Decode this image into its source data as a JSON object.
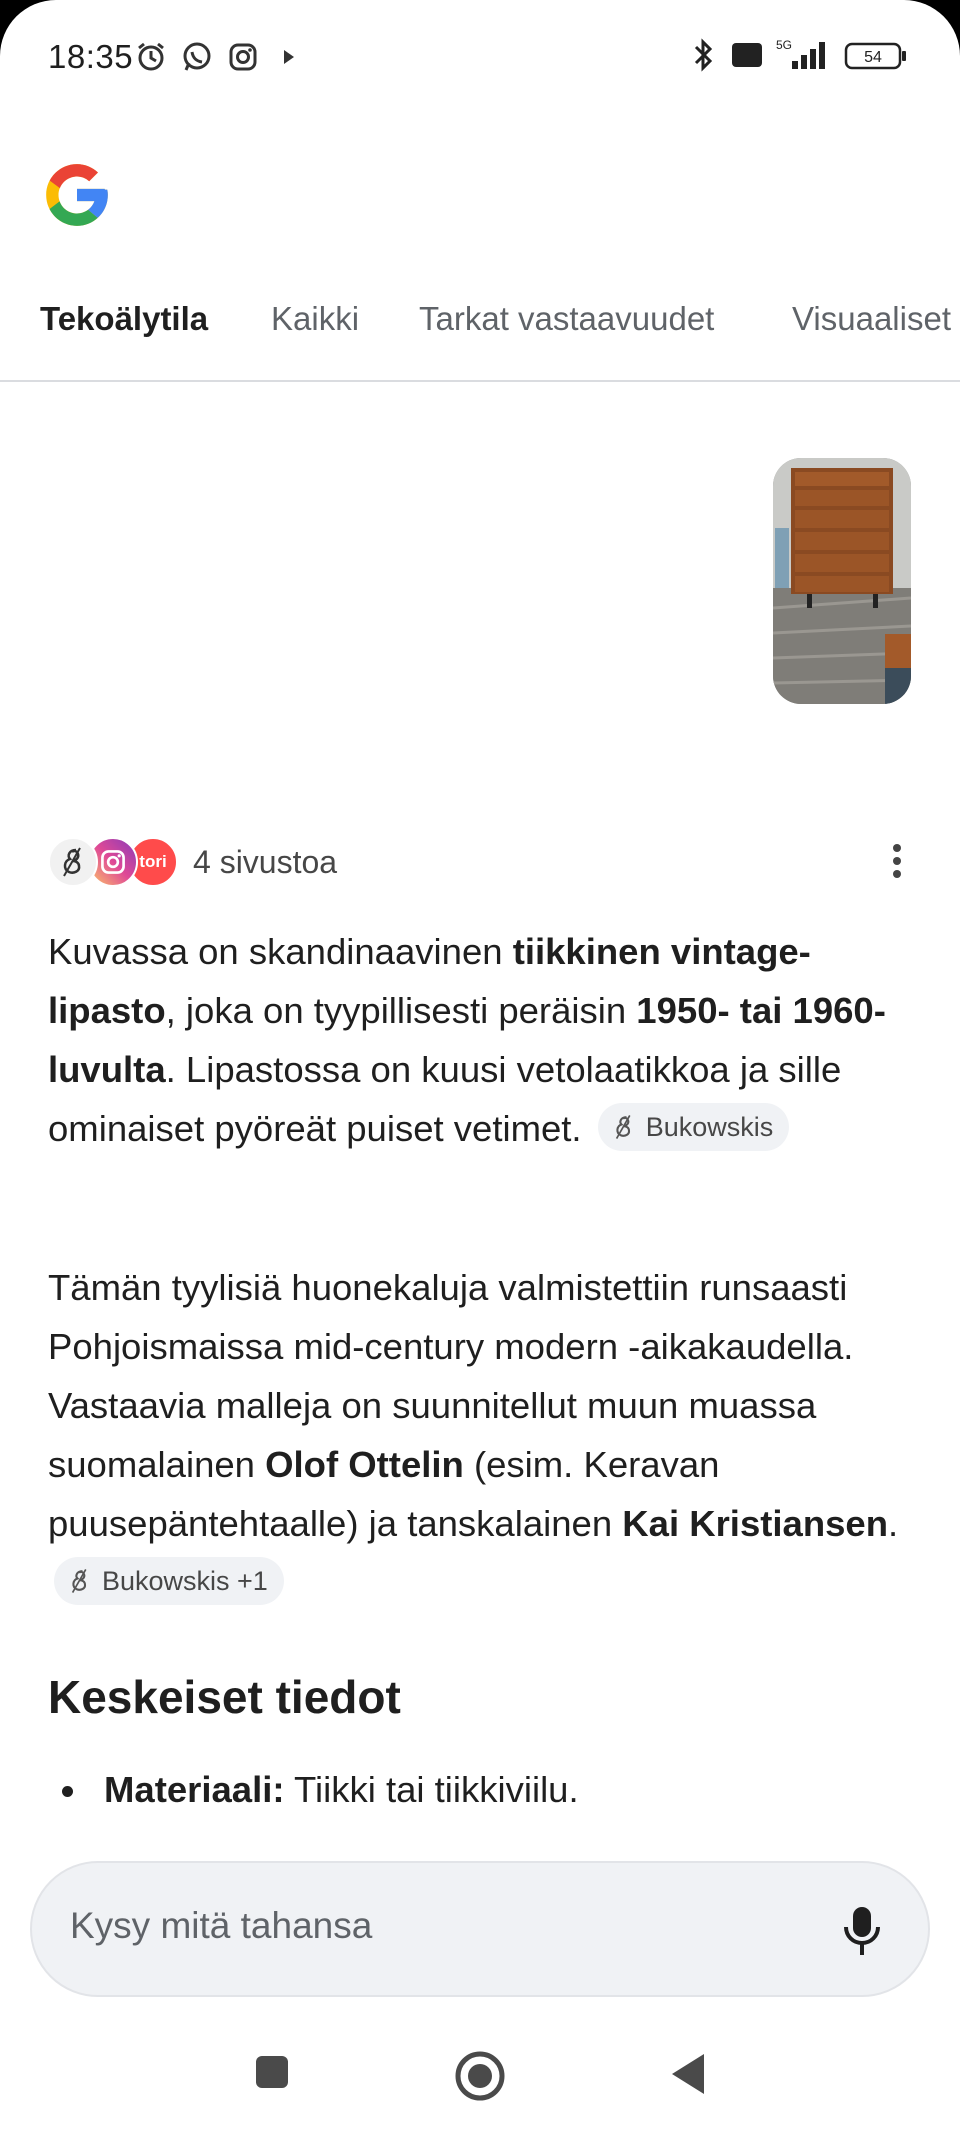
{
  "status_bar": {
    "time": "18:35",
    "left_icons": [
      "alarm-icon",
      "whatsapp-icon",
      "instagram-icon",
      "play-icon"
    ],
    "right_icons": [
      "bluetooth-icon",
      "volte-icon",
      "signal-5g-icon",
      "battery-icon"
    ],
    "network_label": "5G",
    "volte_label": "Vo LTE",
    "battery_level": "54"
  },
  "tabs": [
    {
      "label": "Tekoälytila",
      "active": true
    },
    {
      "label": "Kaikki",
      "active": false
    },
    {
      "label": "Tarkat vastaavuudet",
      "active": false
    },
    {
      "label": "Visuaaliset",
      "active": false
    }
  ],
  "sources": {
    "count_label": "4 sivustoa",
    "icons": [
      "bukowskis-icon",
      "instagram-icon",
      "tori-icon"
    ],
    "tori_label": "tori"
  },
  "answer": {
    "p1": {
      "t1": "Kuvassa on skandinaavinen ",
      "b1": "tiikkinen vintage-lipasto",
      "t2": ", joka on tyypillisesti peräisin ",
      "b2": "1950- tai 1960-luvulta",
      "t3": ". Lipastossa on kuusi vetolaatikkoa ja sille ominaiset pyöreät puiset vetimet.",
      "chip": "Bukowskis"
    },
    "p2": {
      "t1": "Tämän tyylisiä huonekaluja valmistettiin runsaasti Pohjoismaissa mid-century modern -aikakaudella. Vastaavia malleja on suunnitellut muun muassa suomalainen ",
      "b1": "Olof Ottelin",
      "t2": " (esim. Keravan puusepäntehtaalle) ja tanskalainen ",
      "b2": "Kai Kristiansen",
      "t3": ".",
      "chip": "Bukowskis +1"
    },
    "heading": "Keskeiset tiedot",
    "bullet": {
      "label": "Materiaali:",
      "text": " Tiikki tai tiikkiviilu."
    }
  },
  "search": {
    "placeholder": "Kysy mitä tahansa"
  },
  "nav": [
    "recents-button",
    "home-button",
    "back-button"
  ],
  "colors": {
    "google_blue": "#4285F4",
    "google_red": "#EA4335",
    "google_yellow": "#FBBC05",
    "google_green": "#34A853",
    "chip_bg": "#f0f2f5",
    "tori_red": "#ff4b4b"
  }
}
